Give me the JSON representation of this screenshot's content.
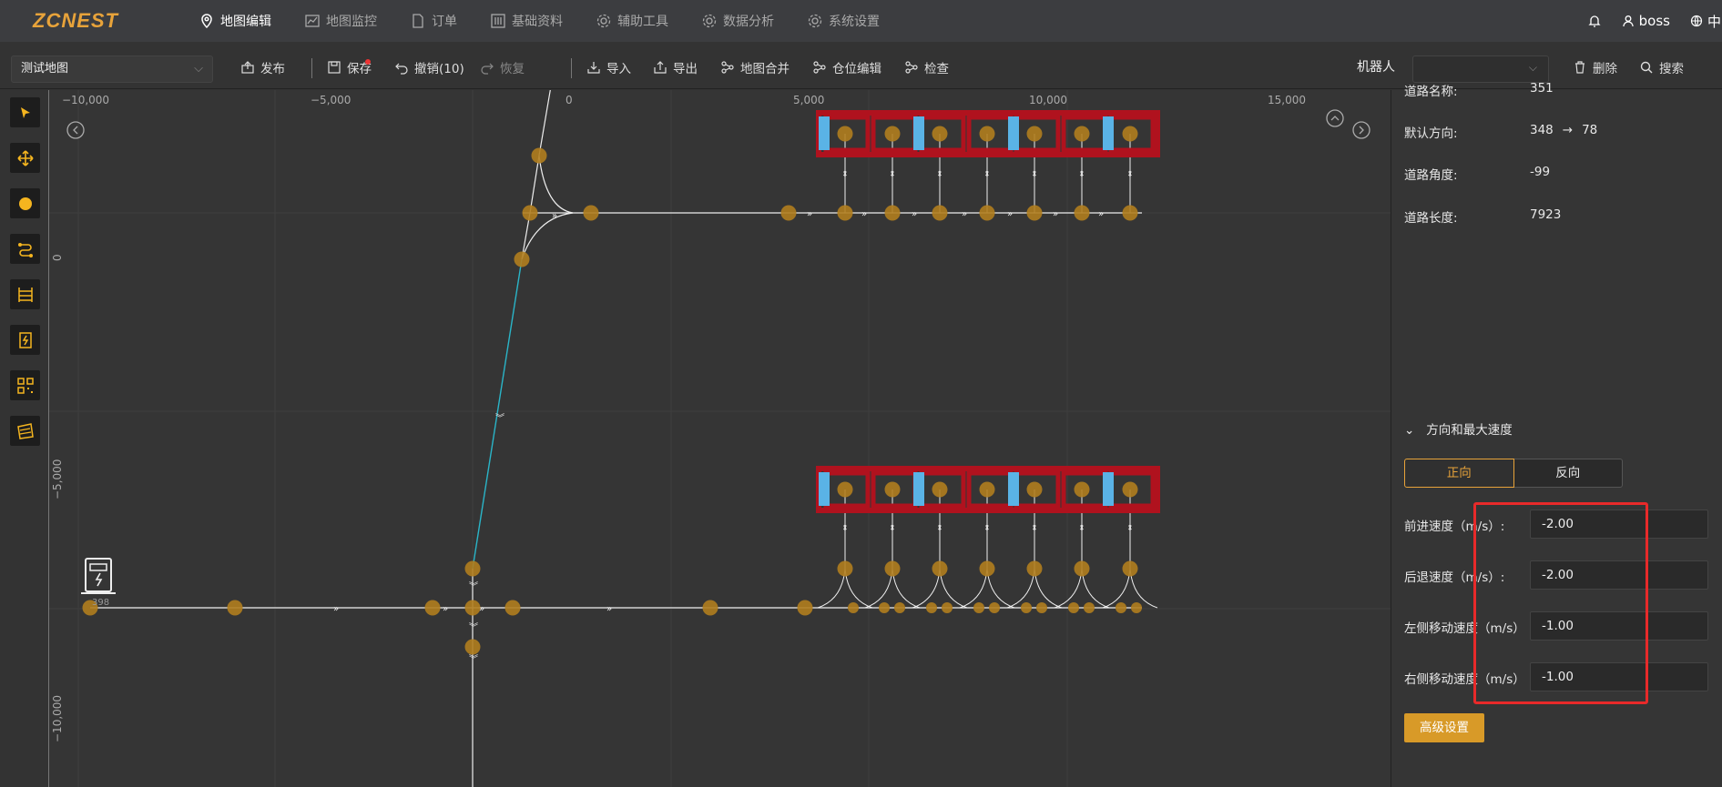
{
  "nav": {
    "logo": "ZCNEST",
    "items": [
      {
        "label": "地图编辑",
        "icon": "map-pin-icon",
        "active": true
      },
      {
        "label": "地图监控",
        "icon": "chart-icon",
        "active": false
      },
      {
        "label": "订单",
        "icon": "document-icon",
        "active": false
      },
      {
        "label": "基础资料",
        "icon": "sliders-icon",
        "active": false
      },
      {
        "label": "辅助工具",
        "icon": "gear-icon",
        "active": false
      },
      {
        "label": "数据分析",
        "icon": "gear-icon",
        "active": false
      },
      {
        "label": "系统设置",
        "icon": "gear-icon",
        "active": false
      }
    ],
    "user": "boss",
    "lang": "中"
  },
  "toolbar": {
    "map_name": "测试地图",
    "publish": "发布",
    "save": "保存",
    "undo": "撤销(10)",
    "redo": "恢复",
    "import": "导入",
    "export": "导出",
    "merge": "地图合并",
    "location_edit": "仓位编辑",
    "check": "检查",
    "robot_label": "机器人",
    "robot_value": "",
    "delete": "删除",
    "search": "搜索"
  },
  "tools": [
    "select-tool-icon",
    "move-tool-icon",
    "point-tool-icon",
    "road-tool-icon",
    "shelf-tool-icon",
    "charger-tool-icon",
    "qr-tool-icon",
    "area-tool-icon"
  ],
  "ruler": {
    "x_ticks": [
      "−10,000",
      "−5,000",
      "0",
      "5,000",
      "10,000",
      "15,000"
    ],
    "y_ticks": [
      "0",
      "−5,000",
      "−10,000"
    ]
  },
  "canvas": {
    "charger_label": "398"
  },
  "panel": {
    "road_name_label": "道路名称:",
    "road_name": "351",
    "direction_label": "默认方向:",
    "direction_from": "348",
    "direction_to": "78",
    "angle_label": "道路角度:",
    "angle": "-99",
    "length_label": "道路长度:",
    "length": "7923",
    "section_title": "方向和最大速度",
    "tab_forward": "正向",
    "tab_reverse": "反向",
    "fields": [
      {
        "label": "前进速度（m/s）:",
        "value": "-2.00"
      },
      {
        "label": "后退速度（m/s）:",
        "value": "-2.00"
      },
      {
        "label": "左侧移动速度（m/s）",
        "value": "-1.00"
      },
      {
        "label": "右侧移动速度（m/s）",
        "value": "-1.00"
      }
    ],
    "advanced": "高级设置"
  },
  "colors": {
    "accent": "#e8a33a",
    "node": "#b07d1e",
    "shelf": "#b0121e",
    "highlight": "#e82a2a",
    "selected_road": "#2ab5c8"
  }
}
